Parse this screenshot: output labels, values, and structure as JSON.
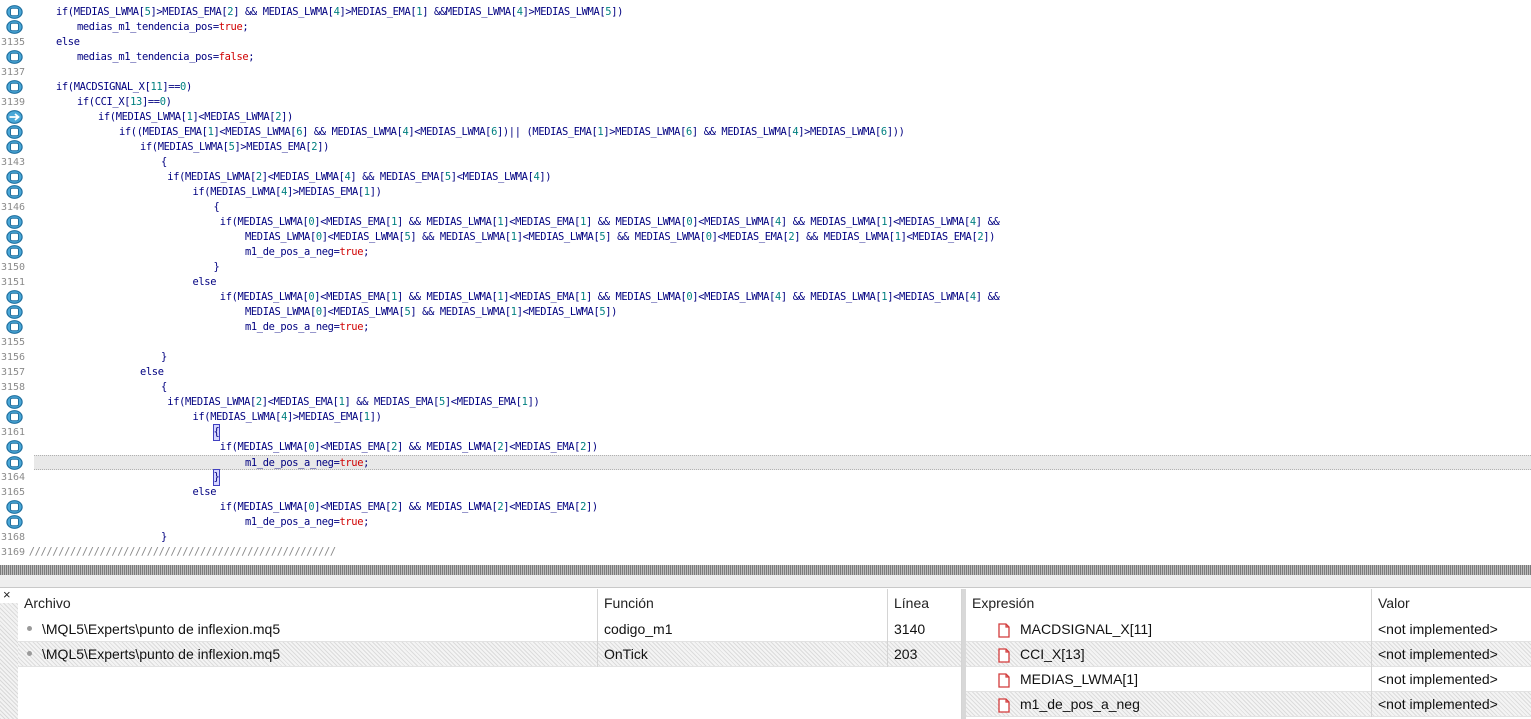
{
  "editor": {
    "lines": [
      {
        "num": "",
        "indent": 0,
        "bp": true,
        "text": "if(MEDIAS_LWMA[5]>MEDIAS_EMA[2] && MEDIAS_LWMA[4]>MEDIAS_EMA[1] &&MEDIAS_LWMA[4]>MEDIAS_LWMA[5])"
      },
      {
        "num": "",
        "indent": 1,
        "bp": true,
        "text": "medias_m1_tendencia_pos=true;"
      },
      {
        "num": "3135",
        "indent": 0,
        "bp": false,
        "text": "else"
      },
      {
        "num": "",
        "indent": 1,
        "bp": true,
        "text": "medias_m1_tendencia_pos=false;"
      },
      {
        "num": "3137",
        "indent": 0,
        "bp": false,
        "text": ""
      },
      {
        "num": "",
        "indent": 0,
        "bp": true,
        "text": "if(MACDSIGNAL_X[11]==0)"
      },
      {
        "num": "3139",
        "indent": 1,
        "bp": false,
        "text": "if(CCI_X[13]==0)"
      },
      {
        "num": "",
        "indent": 2,
        "bp": "arrow",
        "text": "if(MEDIAS_LWMA[1]<MEDIAS_LWMA[2])"
      },
      {
        "num": "",
        "indent": 3,
        "bp": true,
        "text": "if((MEDIAS_EMA[1]<MEDIAS_LWMA[6] && MEDIAS_LWMA[4]<MEDIAS_LWMA[6])|| (MEDIAS_EMA[1]>MEDIAS_LWMA[6] && MEDIAS_LWMA[4]>MEDIAS_LWMA[6]))"
      },
      {
        "num": "",
        "indent": 4,
        "bp": true,
        "text": "if(MEDIAS_LWMA[5]>MEDIAS_EMA[2])"
      },
      {
        "num": "3143",
        "indent": 5,
        "bp": false,
        "text": "{"
      },
      {
        "num": "",
        "indent": 5.3,
        "bp": true,
        "text": "if(MEDIAS_LWMA[2]<MEDIAS_LWMA[4] && MEDIAS_EMA[5]<MEDIAS_LWMA[4])"
      },
      {
        "num": "",
        "indent": 6.5,
        "bp": true,
        "text": "if(MEDIAS_LWMA[4]>MEDIAS_EMA[1])"
      },
      {
        "num": "3146",
        "indent": 7.5,
        "bp": false,
        "text": "{"
      },
      {
        "num": "",
        "indent": 7.8,
        "bp": true,
        "text": "if(MEDIAS_LWMA[0]<MEDIAS_EMA[1] && MEDIAS_LWMA[1]<MEDIAS_EMA[1] && MEDIAS_LWMA[0]<MEDIAS_LWMA[4] && MEDIAS_LWMA[1]<MEDIAS_LWMA[4] &&"
      },
      {
        "num": "",
        "indent": 9,
        "bp": true,
        "text": "MEDIAS_LWMA[0]<MEDIAS_LWMA[5] && MEDIAS_LWMA[1]<MEDIAS_LWMA[5] && MEDIAS_LWMA[0]<MEDIAS_EMA[2] && MEDIAS_LWMA[1]<MEDIAS_EMA[2])"
      },
      {
        "num": "",
        "indent": 9,
        "bp": true,
        "text": "m1_de_pos_a_neg=true;"
      },
      {
        "num": "3150",
        "indent": 7.5,
        "bp": false,
        "text": "}"
      },
      {
        "num": "3151",
        "indent": 6.5,
        "bp": false,
        "text": "else"
      },
      {
        "num": "",
        "indent": 7.8,
        "bp": true,
        "text": "if(MEDIAS_LWMA[0]<MEDIAS_EMA[1] && MEDIAS_LWMA[1]<MEDIAS_EMA[1] && MEDIAS_LWMA[0]<MEDIAS_LWMA[4] && MEDIAS_LWMA[1]<MEDIAS_LWMA[4] &&"
      },
      {
        "num": "",
        "indent": 9,
        "bp": true,
        "text": "MEDIAS_LWMA[0]<MEDIAS_LWMA[5] && MEDIAS_LWMA[1]<MEDIAS_LWMA[5])"
      },
      {
        "num": "",
        "indent": 9,
        "bp": true,
        "text": "m1_de_pos_a_neg=true;"
      },
      {
        "num": "3155",
        "indent": 0,
        "bp": false,
        "text": ""
      },
      {
        "num": "3156",
        "indent": 5,
        "bp": false,
        "text": "}"
      },
      {
        "num": "3157",
        "indent": 4,
        "bp": false,
        "text": "else"
      },
      {
        "num": "3158",
        "indent": 5,
        "bp": false,
        "text": "{"
      },
      {
        "num": "",
        "indent": 5.3,
        "bp": true,
        "text": "if(MEDIAS_LWMA[2]<MEDIAS_EMA[1] && MEDIAS_EMA[5]<MEDIAS_EMA[1])"
      },
      {
        "num": "",
        "indent": 6.5,
        "bp": true,
        "text": "if(MEDIAS_LWMA[4]>MEDIAS_EMA[1])"
      },
      {
        "num": "3161",
        "indent": 7.5,
        "bp": false,
        "text": "{",
        "caret": true
      },
      {
        "num": "",
        "indent": 7.8,
        "bp": true,
        "text": "if(MEDIAS_LWMA[0]<MEDIAS_EMA[2] && MEDIAS_LWMA[2]<MEDIAS_EMA[2])"
      },
      {
        "num": "",
        "indent": 9,
        "bp": true,
        "text": "m1_de_pos_a_neg=true;",
        "current": true
      },
      {
        "num": "3164",
        "indent": 7.5,
        "bp": false,
        "text": "}",
        "caret": true
      },
      {
        "num": "3165",
        "indent": 6.5,
        "bp": false,
        "text": "else"
      },
      {
        "num": "",
        "indent": 7.8,
        "bp": true,
        "text": "if(MEDIAS_LWMA[0]<MEDIAS_EMA[2] && MEDIAS_LWMA[2]<MEDIAS_EMA[2])"
      },
      {
        "num": "",
        "indent": 9,
        "bp": true,
        "text": "m1_de_pos_a_neg=true;"
      },
      {
        "num": "3168",
        "indent": 5,
        "bp": false,
        "text": "}"
      },
      {
        "num": "3169",
        "indent": -1.3,
        "bp": false,
        "text": "////////////////////////////////////////////////////",
        "comment": true
      }
    ]
  },
  "callstack": {
    "headers": {
      "file": "Archivo",
      "func": "Función",
      "line": "Línea"
    },
    "rows": [
      {
        "file": "\\MQL5\\Experts\\punto de inflexion.mq5",
        "func": "codigo_m1",
        "line": "3140"
      },
      {
        "file": "\\MQL5\\Experts\\punto de inflexion.mq5",
        "func": "OnTick",
        "line": "203"
      }
    ]
  },
  "watch": {
    "headers": {
      "expr": "Expresión",
      "value": "Valor"
    },
    "rows": [
      {
        "expr": "MACDSIGNAL_X[11]",
        "value": "<not implemented>"
      },
      {
        "expr": "CCI_X[13]",
        "value": "<not implemented>"
      },
      {
        "expr": "MEDIAS_LWMA[1]",
        "value": "<not implemented>"
      },
      {
        "expr": "m1_de_pos_a_neg",
        "value": "<not implemented>"
      }
    ]
  },
  "close_glyph": "×",
  "icons": {
    "breakpoint": "breakpoint-icon",
    "current": "execution-arrow-icon",
    "watch": "watch-expression-icon",
    "close": "close-icon"
  }
}
